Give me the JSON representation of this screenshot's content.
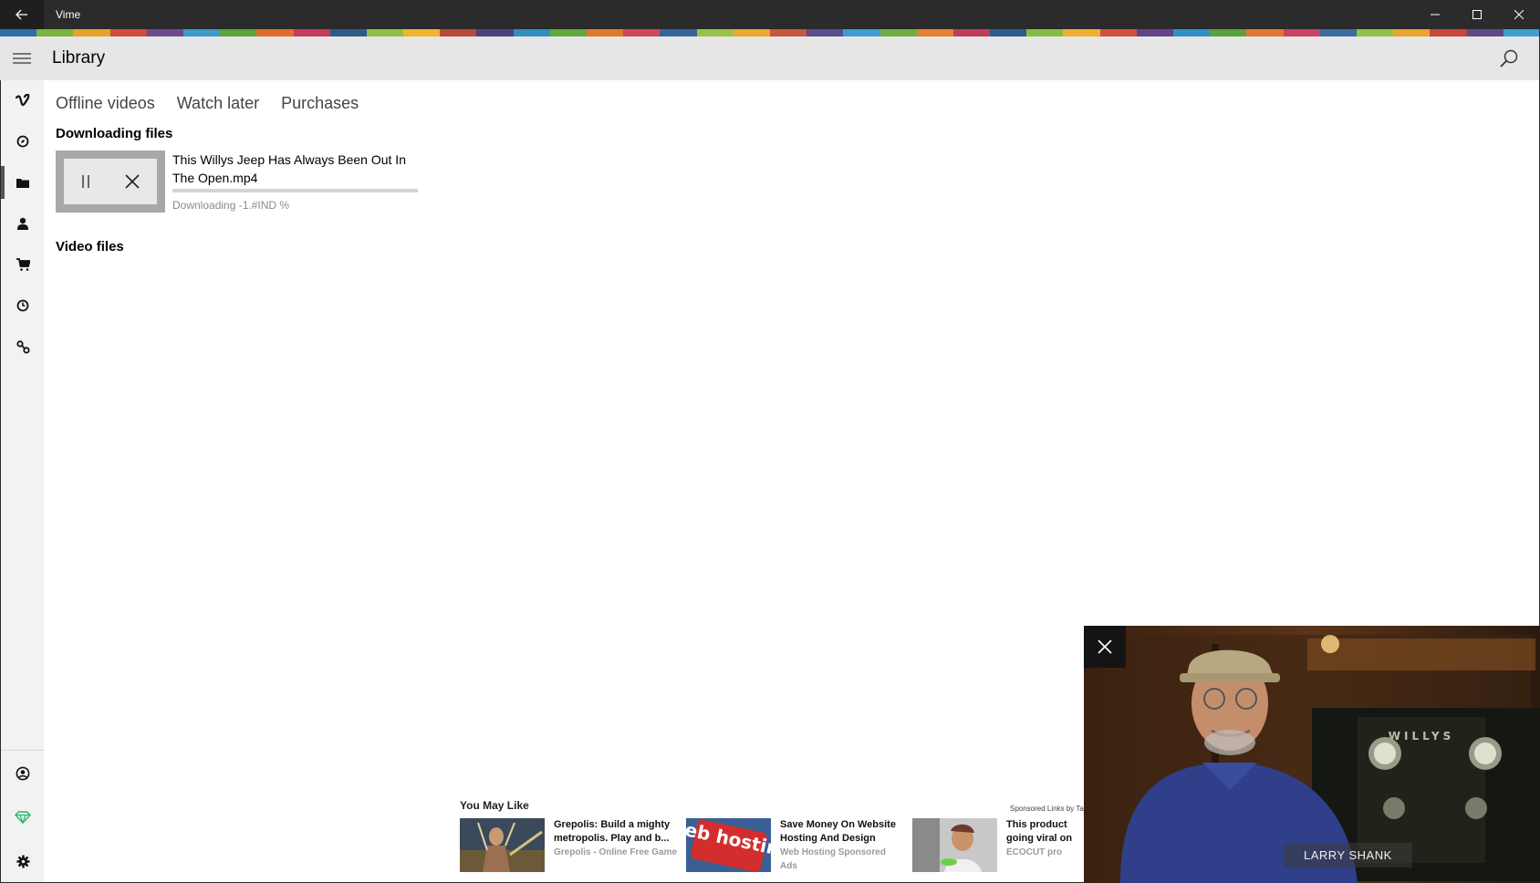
{
  "window": {
    "title": "Vime",
    "stripe_colors": [
      "#2c6fa8",
      "#7bb33f",
      "#e8a22b",
      "#d14b3e",
      "#6a4b8c",
      "#3a9ac9",
      "#5aa43a",
      "#e06d2a",
      "#c43b5c",
      "#2e5a8a",
      "#8fbf45",
      "#f0b42f",
      "#b74a3a",
      "#50407c",
      "#2f8fc0",
      "#61a83d",
      "#dd7a2c",
      "#cf4759",
      "#35649b",
      "#9ac24b",
      "#e9a830",
      "#c9563f",
      "#5d4c8e",
      "#3c9dd1",
      "#70ad41",
      "#e58031",
      "#bf3e57",
      "#2d5b8f",
      "#86bc44",
      "#efae33",
      "#d2513f",
      "#63438a",
      "#2f91c4",
      "#59a23b",
      "#e27731",
      "#c84460",
      "#3a6da0",
      "#93c148",
      "#eaa42f",
      "#c7463d",
      "#5b4a86",
      "#3ca0cf"
    ]
  },
  "header": {
    "title": "Library",
    "menu_icon": "hamburger-icon",
    "search_icon": "search-icon"
  },
  "nav_rail": {
    "items": [
      {
        "name": "vimeo-logo-icon",
        "label": "Vimeo"
      },
      {
        "name": "compass-icon",
        "label": "Explore"
      },
      {
        "name": "folder-icon",
        "label": "Library",
        "selected": true
      },
      {
        "name": "person-icon",
        "label": "Me"
      },
      {
        "name": "cart-icon",
        "label": "Purchases"
      },
      {
        "name": "clock-icon",
        "label": "Watch later"
      },
      {
        "name": "link-icon",
        "label": "Links"
      }
    ],
    "bottom_items": [
      {
        "name": "account-icon",
        "label": "Account"
      },
      {
        "name": "diamond-icon",
        "label": "Premium",
        "color": "#2bb673"
      },
      {
        "name": "settings-gear-icon",
        "label": "Settings"
      }
    ]
  },
  "tabs": [
    "Offline videos",
    "Watch later",
    "Purchases"
  ],
  "downloading": {
    "heading": "Downloading files",
    "file_name": "This Willys Jeep Has Always Been Out In The Open.mp4",
    "status": "Downloading -1.#IND %",
    "progress_fraction": 0
  },
  "video_files": {
    "heading": "Video files"
  },
  "ads": {
    "heading": "You May Like",
    "sponsored_label": "Sponsored Links by Taboola",
    "items": [
      {
        "title": "Grepolis: Build a mighty metropolis. Play and b...",
        "source": "Grepolis - Online Free Game"
      },
      {
        "title": "Save Money On Website Hosting And Design",
        "source": "Web Hosting Sponsored Ads",
        "image_text": "web hosting"
      },
      {
        "title": "This product going viral on the internet. T",
        "source": "ECOCUT pro"
      }
    ]
  },
  "video_player": {
    "caption": "LARRY SHANK",
    "jeep_text": "WILLYS",
    "close_icon": "close-icon"
  }
}
